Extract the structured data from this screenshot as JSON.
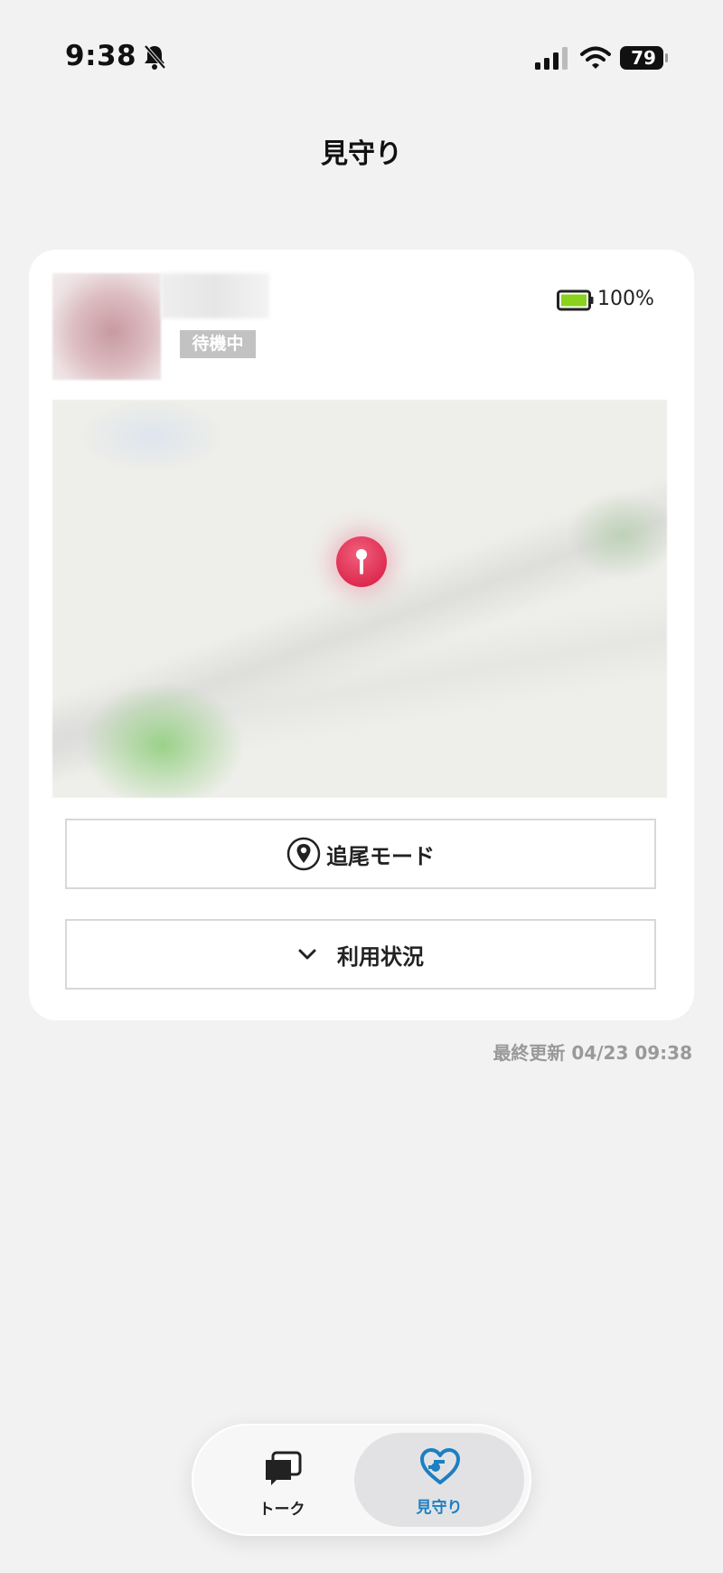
{
  "status_bar": {
    "time": "9:38",
    "battery_percent": "79",
    "icons": [
      "bell-slash-icon",
      "cellular-signal-icon",
      "wifi-icon",
      "battery-icon"
    ]
  },
  "header": {
    "title": "見守り"
  },
  "device_card": {
    "status_badge": "待機中",
    "battery_text": "100%",
    "battery_level": 1.0,
    "map": {
      "pin_icon": "map-pin-icon",
      "pin_color": "#d6163f"
    },
    "follow_mode_label": "追尾モード",
    "follow_mode_icon": "location-marker-icon",
    "usage_label": "利用状況",
    "usage_icon": "chevron-down-icon"
  },
  "last_updated": "最終更新 04/23 09:38",
  "tab_bar": {
    "tabs": [
      {
        "label": "トーク",
        "icon": "chat-bubbles-icon",
        "selected": false
      },
      {
        "label": "見守り",
        "icon": "heart-icon",
        "selected": true
      }
    ],
    "accent_color": "#1d7fc2"
  }
}
